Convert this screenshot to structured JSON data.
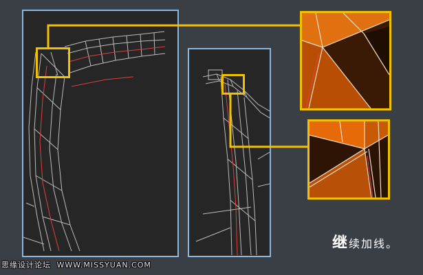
{
  "caption": {
    "first_char": "继",
    "rest": "续加线。"
  },
  "watermark": {
    "site_name": "思缘设计论坛",
    "site_url": "WWW.MISSYUAN.COM"
  },
  "colors": {
    "background": "#3a3f46",
    "viewport_bg": "#262626",
    "viewport_border": "#8ab8e0",
    "highlight": "#f2c200",
    "wire": "#d8d8d8",
    "spline": "#e04040",
    "zoom_fill": "#c85a06",
    "zoom_dark": "#3a1a04"
  },
  "viewports": [
    {
      "id": "viewport-left",
      "icon": "wireframe-arch-left"
    },
    {
      "id": "viewport-right",
      "icon": "wireframe-arch-right"
    }
  ]
}
